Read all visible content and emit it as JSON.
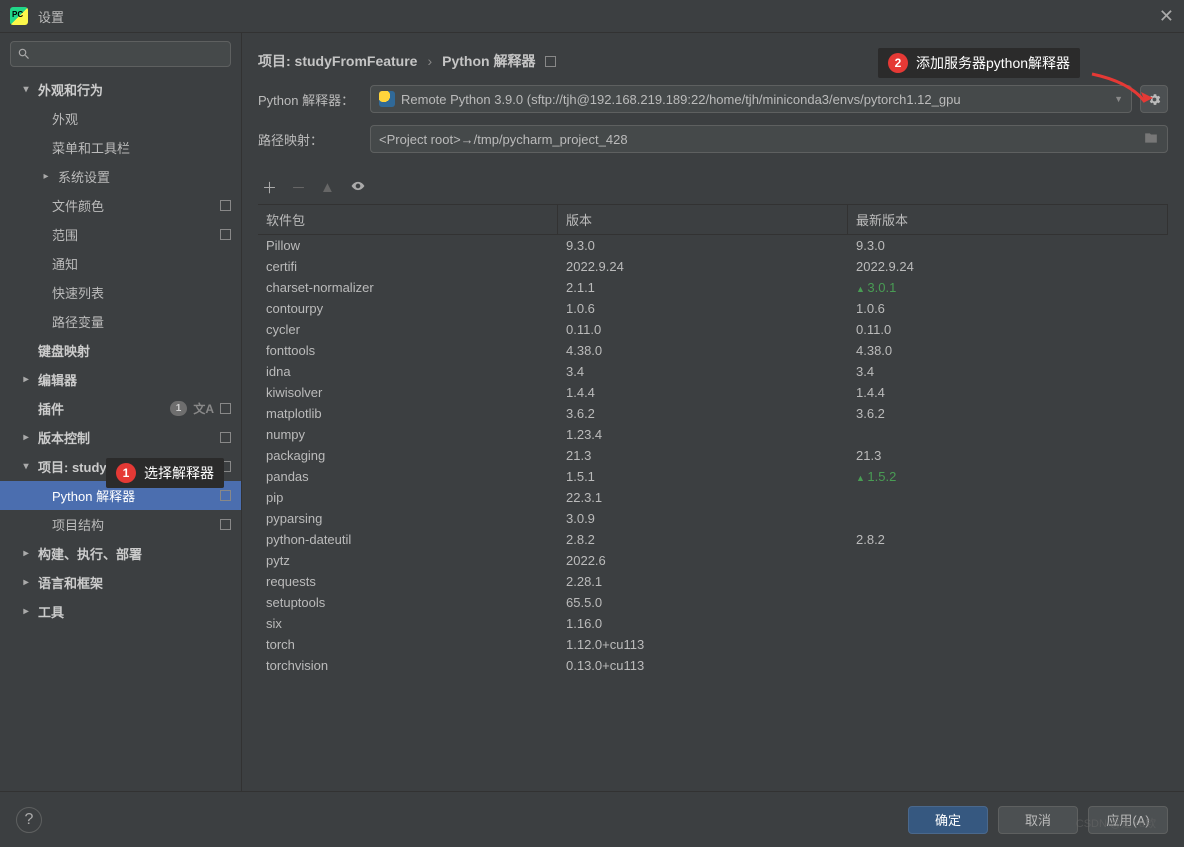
{
  "titlebar": {
    "title": "设置"
  },
  "sidebar": {
    "items": [
      {
        "label": "外观和行为",
        "bold": true,
        "chev": "▾"
      },
      {
        "label": "外观",
        "child": true
      },
      {
        "label": "菜单和工具栏",
        "child": true
      },
      {
        "label": "系统设置",
        "sub": true,
        "chev": "▸"
      },
      {
        "label": "文件颜色",
        "child": true,
        "sq": true
      },
      {
        "label": "范围",
        "child": true,
        "sq": true
      },
      {
        "label": "通知",
        "child": true
      },
      {
        "label": "快速列表",
        "child": true
      },
      {
        "label": "路径变量",
        "child": true
      },
      {
        "label": "键盘映射",
        "bold": true
      },
      {
        "label": "编辑器",
        "bold": true,
        "chev": "▸"
      },
      {
        "label": "插件",
        "bold": true,
        "badge": "1",
        "lang": true,
        "sq": true
      },
      {
        "label": "版本控制",
        "bold": true,
        "chev": "▸",
        "sq": true
      },
      {
        "label": "项目: studyFromFeature",
        "bold": true,
        "chev": "▾",
        "sq": true
      },
      {
        "label": "Python 解释器",
        "child": true,
        "selected": true,
        "sq": true
      },
      {
        "label": "项目结构",
        "child": true,
        "sq": true
      },
      {
        "label": "构建、执行、部署",
        "bold": true,
        "chev": "▸"
      },
      {
        "label": "语言和框架",
        "bold": true,
        "chev": "▸"
      },
      {
        "label": "工具",
        "bold": true,
        "chev": "▸"
      }
    ]
  },
  "breadcrumb": {
    "project": "项目: studyFromFeature",
    "sep": "›",
    "page": "Python 解释器"
  },
  "form": {
    "interpreter_label": "Python 解释器：",
    "interpreter_value": "Remote Python 3.9.0 (sftp://tjh@192.168.219.189:22/home/tjh/miniconda3/envs/pytorch1.12_gpu",
    "path_label": "路径映射：",
    "path_value": "<Project root>→/tmp/pycharm_project_428"
  },
  "table": {
    "headers": {
      "pkg": "软件包",
      "ver": "版本",
      "latest": "最新版本"
    },
    "rows": [
      {
        "pkg": "Pillow",
        "ver": "9.3.0",
        "latest": "9.3.0"
      },
      {
        "pkg": "certifi",
        "ver": "2022.9.24",
        "latest": "2022.9.24"
      },
      {
        "pkg": "charset-normalizer",
        "ver": "2.1.1",
        "latest": "3.0.1",
        "up": true
      },
      {
        "pkg": "contourpy",
        "ver": "1.0.6",
        "latest": "1.0.6"
      },
      {
        "pkg": "cycler",
        "ver": "0.11.0",
        "latest": "0.11.0"
      },
      {
        "pkg": "fonttools",
        "ver": "4.38.0",
        "latest": "4.38.0"
      },
      {
        "pkg": "idna",
        "ver": "3.4",
        "latest": "3.4"
      },
      {
        "pkg": "kiwisolver",
        "ver": "1.4.4",
        "latest": "1.4.4"
      },
      {
        "pkg": "matplotlib",
        "ver": "3.6.2",
        "latest": "3.6.2"
      },
      {
        "pkg": "numpy",
        "ver": "1.23.4",
        "latest": ""
      },
      {
        "pkg": "packaging",
        "ver": "21.3",
        "latest": "21.3"
      },
      {
        "pkg": "pandas",
        "ver": "1.5.1",
        "latest": "1.5.2",
        "up": true
      },
      {
        "pkg": "pip",
        "ver": "22.3.1",
        "latest": ""
      },
      {
        "pkg": "pyparsing",
        "ver": "3.0.9",
        "latest": ""
      },
      {
        "pkg": "python-dateutil",
        "ver": "2.8.2",
        "latest": "2.8.2"
      },
      {
        "pkg": "pytz",
        "ver": "2022.6",
        "latest": ""
      },
      {
        "pkg": "requests",
        "ver": "2.28.1",
        "latest": ""
      },
      {
        "pkg": "setuptools",
        "ver": "65.5.0",
        "latest": ""
      },
      {
        "pkg": "six",
        "ver": "1.16.0",
        "latest": ""
      },
      {
        "pkg": "torch",
        "ver": "1.12.0+cu113",
        "latest": ""
      },
      {
        "pkg": "torchvision",
        "ver": "0.13.0+cu113",
        "latest": ""
      }
    ]
  },
  "footer": {
    "ok": "确定",
    "cancel": "取消",
    "apply": "应用(A)"
  },
  "annotations": {
    "a1_num": "1",
    "a1_text": "选择解释器",
    "a2_num": "2",
    "a2_text": "添加服务器python解释器"
  },
  "watermark": "CSDN @是Yu欸"
}
